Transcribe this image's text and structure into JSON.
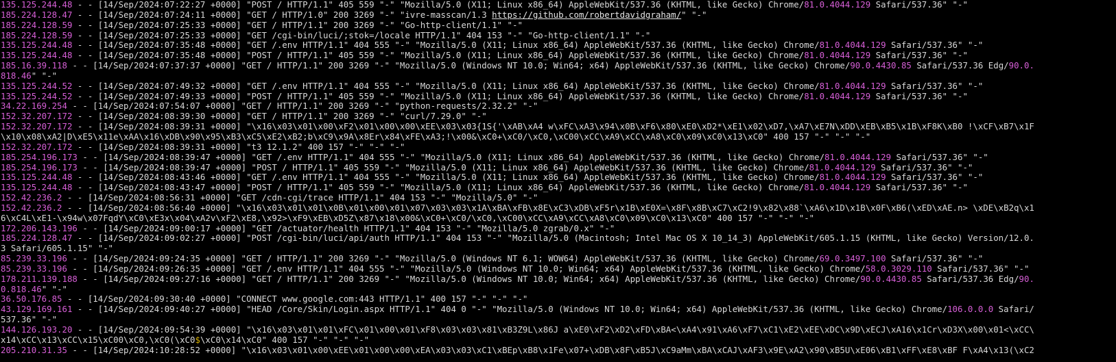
{
  "colors": {
    "background": "#000000",
    "text": "#d9d9d9",
    "ip": "#d75fd7",
    "version": "#d75fd7",
    "dollar": "#d7af00"
  },
  "lines": [
    [
      {
        "t": "135.125.244.48",
        "c": "ip"
      },
      {
        "t": " - - [14/Sep/2024:07:22:27 +0000] \"POST / HTTP/1.1\" 405 559 \"-\" \"Mozilla/5.0 (X11; Linux x86_64) AppleWebKit/537.36 (KHTML, like Gecko) Chrome/"
      },
      {
        "t": "81.0.4044.129",
        "c": "ver"
      },
      {
        "t": " Safari/537.36\" \"-\""
      }
    ],
    [
      {
        "t": "185.224.128.47",
        "c": "ip"
      },
      {
        "t": " - - [14/Sep/2024:07:24:11 +0000] \"GET / HTTP/1.0\" 200 3269 \"-\" \"ivre-masscan/1.3 "
      },
      {
        "t": "https://github.com/robertdavidgraham/",
        "c": "url"
      },
      {
        "t": "\" \"-\""
      }
    ],
    [
      {
        "t": "185.224.128.59",
        "c": "ip"
      },
      {
        "t": " - - [14/Sep/2024:07:25:33 +0000] \"GET / HTTP/1.1\" 200 3269 \"-\" \"Go-http-client/1.1\" \"-\""
      }
    ],
    [
      {
        "t": "185.224.128.59",
        "c": "ip"
      },
      {
        "t": " - - [14/Sep/2024:07:25:33 +0000] \"GET /cgi-bin/luci/;stok=/locale HTTP/1.1\" 404 153 \"-\" \"Go-http-client/1.1\" \"-\""
      }
    ],
    [
      {
        "t": "135.125.244.48",
        "c": "ip"
      },
      {
        "t": " - - [14/Sep/2024:07:35:48 +0000] \"GET /.env HTTP/1.1\" 404 555 \"-\" \"Mozilla/5.0 (X11; Linux x86_64) AppleWebKit/537.36 (KHTML, like Gecko) Chrome/"
      },
      {
        "t": "81.0.4044.129",
        "c": "ver"
      },
      {
        "t": " Safari/537.36\" \"-\""
      }
    ],
    [
      {
        "t": "135.125.244.48",
        "c": "ip"
      },
      {
        "t": " - - [14/Sep/2024:07:35:48 +0000] \"POST / HTTP/1.1\" 405 559 \"-\" \"Mozilla/5.0 (X11; Linux x86_64) AppleWebKit/537.36 (KHTML, like Gecko) Chrome/"
      },
      {
        "t": "81.0.4044.129",
        "c": "ver"
      },
      {
        "t": " Safari/537.36\" \"-\""
      }
    ],
    [
      {
        "t": "185.16.39.118",
        "c": "ip"
      },
      {
        "t": " - - [14/Sep/2024:07:37:37 +0000] \"GET / HTTP/1.1\" 200 3269 \"-\" \"Mozilla/5.0 (Windows NT 10.0; Win64; x64) AppleWebKit/537.36 (KHTML, like Gecko) Chrome/"
      },
      {
        "t": "90.0.4430.85",
        "c": "ver"
      },
      {
        "t": " Safari/537.36 Edg/"
      },
      {
        "t": "90.0.",
        "c": "ver"
      }
    ],
    [
      {
        "t": "818.46",
        "c": "ver"
      },
      {
        "t": "\" \"-\""
      }
    ],
    [
      {
        "t": "135.125.244.52",
        "c": "ip"
      },
      {
        "t": " - - [14/Sep/2024:07:49:32 +0000] \"GET /.env HTTP/1.1\" 404 555 \"-\" \"Mozilla/5.0 (X11; Linux x86_64) AppleWebKit/537.36 (KHTML, like Gecko) Chrome/"
      },
      {
        "t": "81.0.4044.129",
        "c": "ver"
      },
      {
        "t": " Safari/537.36\" \"-\""
      }
    ],
    [
      {
        "t": "135.125.244.52",
        "c": "ip"
      },
      {
        "t": " - - [14/Sep/2024:07:49:33 +0000] \"POST / HTTP/1.1\" 405 559 \"-\" \"Mozilla/5.0 (X11; Linux x86_64) AppleWebKit/537.36 (KHTML, like Gecko) Chrome/"
      },
      {
        "t": "81.0.4044.129",
        "c": "ver"
      },
      {
        "t": " Safari/537.36\" \"-\""
      }
    ],
    [
      {
        "t": "34.22.169.254",
        "c": "ip"
      },
      {
        "t": " - - [14/Sep/2024:07:54:07 +0000] \"GET / HTTP/1.1\" 200 3269 \"-\" \"python-requests/2.32.2\" \"-\""
      }
    ],
    [
      {
        "t": "152.32.207.172",
        "c": "ip"
      },
      {
        "t": " - - [14/Sep/2024:08:39:30 +0000] \"GET / HTTP/1.1\" 200 3269 \"-\" \"curl/7.29.0\" \"-\""
      }
    ],
    [
      {
        "t": "152.32.207.172",
        "c": "ip"
      },
      {
        "t": " - - [14/Sep/2024:08:39:31 +0000] \"\\x16\\x03\\x01\\x00\\xF2\\x01\\x00\\x00\\xEE\\x03\\x03{1S{'\\xAB\\xA4 w\\xFC\\xA3\\x94\\x0B\\xF6\\x80\\xE0\\xD2*\\xE1\\x02\\xD7,\\xA7\\xE7N\\xDD\\xEB\\xB5\\x1B\\xF8K\\xB0 !\\xCF\\xB7\\x1F"
      }
    ],
    [
      {
        "t": "\\x10\\x08\\xA2|D\\xE5\\x11e\\xAA\\x16\\xDB\\x90\\x95\\xB3\\xC5\\xE2\\xB2;b\\xC9\\x9A\\x8Er\\x84\\xFE\\xA3;!\\x00&\\xC0+\\xC0/\\xC0,\\xC00\\xCC\\xA9\\xCC\\xA8\\xC0\\x09\\xC0\\x13\\xC0\" 400 157 \"-\" \"-\" \"-\""
      }
    ],
    [
      {
        "t": "152.32.207.172",
        "c": "ip"
      },
      {
        "t": " - - [14/Sep/2024:08:39:31 +0000] \"t3 12.1.2\" 400 157 \"-\" \"-\" \"-\""
      }
    ],
    [
      {
        "t": "185.254.196.173",
        "c": "ip"
      },
      {
        "t": " - - [14/Sep/2024:08:39:47 +0000] \"GET /.env HTTP/1.1\" 404 555 \"-\" \"Mozilla/5.0 (X11; Linux x86_64) AppleWebKit/537.36 (KHTML, like Gecko) Chrome/"
      },
      {
        "t": "81.0.4044.129",
        "c": "ver"
      },
      {
        "t": " Safari/537.36\" \"-\""
      }
    ],
    [
      {
        "t": "185.254.196.173",
        "c": "ip"
      },
      {
        "t": " - - [14/Sep/2024:08:39:47 +0000] \"POST / HTTP/1.1\" 405 559 \"-\" \"Mozilla/5.0 (X11; Linux x86_64) AppleWebKit/537.36 (KHTML, like Gecko) Chrome/"
      },
      {
        "t": "81.0.4044.129",
        "c": "ver"
      },
      {
        "t": " Safari/537.36\" \"-\""
      }
    ],
    [
      {
        "t": "135.125.244.48",
        "c": "ip"
      },
      {
        "t": " - - [14/Sep/2024:08:43:46 +0000] \"GET /.env HTTP/1.1\" 404 555 \"-\" \"Mozilla/5.0 (X11; Linux x86_64) AppleWebKit/537.36 (KHTML, like Gecko) Chrome/"
      },
      {
        "t": "81.0.4044.129",
        "c": "ver"
      },
      {
        "t": " Safari/537.36\" \"-\""
      }
    ],
    [
      {
        "t": "135.125.244.48",
        "c": "ip"
      },
      {
        "t": " - - [14/Sep/2024:08:43:47 +0000] \"POST / HTTP/1.1\" 405 559 \"-\" \"Mozilla/5.0 (X11; Linux x86_64) AppleWebKit/537.36 (KHTML, like Gecko) Chrome/"
      },
      {
        "t": "81.0.4044.129",
        "c": "ver"
      },
      {
        "t": " Safari/537.36\" \"-\""
      }
    ],
    [
      {
        "t": "152.42.236.2",
        "c": "ip"
      },
      {
        "t": " - - [14/Sep/2024:08:56:31 +0000] \"GET /cdn-cgi/trace HTTP/1.1\" 404 153 \"-\" \"Mozilla/5.0\" \"-\""
      }
    ],
    [
      {
        "t": "152.42.236.2",
        "c": "ip"
      },
      {
        "t": " - - [14/Sep/2024:08:56:40 +0000] \"\\x16\\x03\\x01\\x01\\x0B\\x01\\x00\\x01\\x07\\x03\\x03\\x1A\\xBA\\xFB\\x8E\\xC3\\xDB\\xF5r\\x1B\\xE0X=\\x8F\\x8B\\xC7\\xC2!9\\x82\\x88`\\xA6\\x1D\\x1B\\x0F\\xB6(\\xED\\xAE.n> \\xDE\\xB2q\\x1"
      }
    ],
    [
      {
        "t": "6\\xC4L\\xE1-\\x94w\\x07FqdY\\xC0\\xE3x\\x04\\xA2v\\xF2\\xE8,\\x92>\\xF9\\xEB\\xD5Z\\x87\\x18\\x00&\\xC0+\\xC0/\\xC0,\\xC00\\xCC\\xA9\\xCC\\xA8\\xC0\\x09\\xC0\\x13\\xC0\" 400 157 \"-\" \"-\" \"-\""
      }
    ],
    [
      {
        "t": "172.206.143.196",
        "c": "ip"
      },
      {
        "t": " - - [14/Sep/2024:09:00:17 +0000] \"GET /actuator/health HTTP/1.1\" 404 153 \"-\" \"Mozilla/5.0 zgrab/0.x\" \"-\""
      }
    ],
    [
      {
        "t": "185.224.128.47",
        "c": "ip"
      },
      {
        "t": " - - [14/Sep/2024:09:02:27 +0000] \"POST /cgi-bin/luci/api/auth HTTP/1.1\" 404 153 \"-\" \"Mozilla/5.0 (Macintosh; Intel Mac OS X 10_14_3) AppleWebKit/605.1.15 (KHTML, like Gecko) Version/12.0."
      }
    ],
    [
      {
        "t": "3 Safari/605.1.15\" \"-\""
      }
    ],
    [
      {
        "t": "85.239.33.196",
        "c": "ip"
      },
      {
        "t": " - - [14/Sep/2024:09:24:35 +0000] \"GET / HTTP/1.1\" 200 3269 \"-\" \"Mozilla/5.0 (Windows NT 6.1; WOW64) AppleWebKit/537.36 (KHTML, like Gecko) Chrome/"
      },
      {
        "t": "69.0.3497.100",
        "c": "ver"
      },
      {
        "t": " Safari/537.36\" \"-\""
      }
    ],
    [
      {
        "t": "85.239.33.196",
        "c": "ip"
      },
      {
        "t": " - - [14/Sep/2024:09:26:35 +0000] \"GET /.env HTTP/1.1\" 404 555 \"-\" \"Mozilla/5.0 (Windows NT 10.0; Win64; x64) AppleWebKit/537.36 (KHTML, like Gecko) Chrome/"
      },
      {
        "t": "58.0.3029.110",
        "c": "ver"
      },
      {
        "t": " Safari/537.36\" \"-\""
      }
    ],
    [
      {
        "t": "178.211.139.188",
        "c": "ip"
      },
      {
        "t": " - - [14/Sep/2024:09:27:16 +0000] \"GET / HTTP/1.1\" 200 3269 \"-\" \"Mozilla/5.0 (Windows NT 10.0; Win64; x64) AppleWebKit/537.36 (KHTML, like Gecko) Chrome/"
      },
      {
        "t": "90.0.4430.85",
        "c": "ver"
      },
      {
        "t": " Safari/537.36 Edg/"
      },
      {
        "t": "90.",
        "c": "ver"
      }
    ],
    [
      {
        "t": "0.818.46",
        "c": "ver"
      },
      {
        "t": "\" \"-\""
      }
    ],
    [
      {
        "t": "36.50.176.85",
        "c": "ip"
      },
      {
        "t": " - - [14/Sep/2024:09:30:40 +0000] \"CONNECT www.google.com:443 HTTP/1.1\" 400 157 \"-\" \"-\" \"-\""
      }
    ],
    [
      {
        "t": "43.129.169.161",
        "c": "ip"
      },
      {
        "t": " - - [14/Sep/2024:09:40:27 +0000] \"HEAD /Core/Skin/Login.aspx HTTP/1.1\" 404 0 \"-\" \"Mozilla/5.0 (Windows NT 10.0; Win64; x64) AppleWebKit/537.36 (KHTML, like Gecko) Chrome/"
      },
      {
        "t": "106.0.0.0",
        "c": "ver"
      },
      {
        "t": " Safari/"
      }
    ],
    [
      {
        "t": "537.36\" \"-\""
      }
    ],
    [
      {
        "t": "144.126.193.20",
        "c": "ip"
      },
      {
        "t": " - - [14/Sep/2024:09:54:39 +0000] \"\\x16\\x03\\x01\\x01\\xFC\\x01\\x00\\x01\\xF8\\x03\\x03\\x81\\xB3Z9L\\x86J a\\xE0\\xF2\\xD2\\xFD\\xBA<\\xA4\\x91\\xA6\\xF7\\xC1\\xE2\\xEE\\xDC\\x9D\\xECJ\\xA16\\x1Cr\\xD3X\\x00\\x01<\\xCC\\"
      }
    ],
    [
      {
        "t": "x14\\xCC\\x13\\xCC\\x15\\xC00\\xC0,\\xC0(\\xC0"
      },
      {
        "t": "$",
        "c": "dollar"
      },
      {
        "t": "\\xC0\\x14\\xC0\" 400 157 \"-\" \"-\" \"-\""
      }
    ],
    [
      {
        "t": "205.210.31.35",
        "c": "ip"
      },
      {
        "t": " - - [14/Sep/2024:10:28:52 +0000] \"\\x16\\x03\\x01\\x00\\xEE\\x01\\x00\\x00\\xEA\\x03\\x03\\xC1\\xBEp\\xB8\\x1Fe\\x07+\\xDB\\x8F\\xB5J\\xC9aMm\\xBA\\xCAJ\\xAF3\\x9E\\xA2\\x90\\xB5U\\xE06\\xB1\\xFF\\xE8\\xBF F\\xA4\\x13(\\xC2"
      }
    ]
  ]
}
